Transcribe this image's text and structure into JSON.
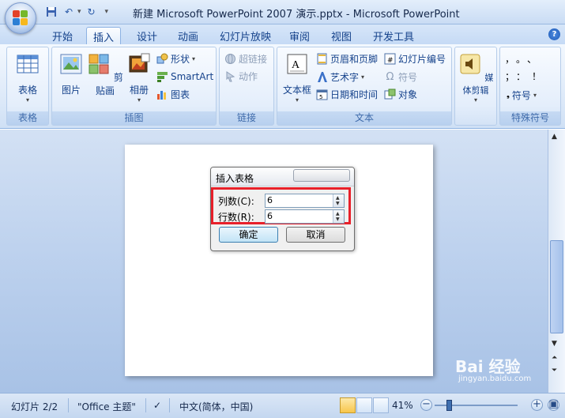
{
  "window": {
    "title": "新建 Microsoft PowerPoint 2007 演示.pptx - Microsoft PowerPoint"
  },
  "quick_access": {
    "save_icon": "save-icon",
    "undo_icon": "undo-icon",
    "redo_icon": "redo-icon"
  },
  "tabs": [
    {
      "label": "开始"
    },
    {
      "label": "插入",
      "active": true
    },
    {
      "label": "设计"
    },
    {
      "label": "动画"
    },
    {
      "label": "幻灯片放映"
    },
    {
      "label": "审阅"
    },
    {
      "label": "视图"
    },
    {
      "label": "开发工具"
    }
  ],
  "ribbon": {
    "groups": {
      "table": {
        "label": "表格",
        "button": "表格"
      },
      "illustrations": {
        "label": "插图",
        "picture": "图片",
        "clipart": "剪贴画",
        "album": "相册",
        "shapes": "形状",
        "smartart": "SmartArt",
        "chart": "图表"
      },
      "links": {
        "label": "链接",
        "hyperlink": "超链接",
        "action": "动作"
      },
      "text": {
        "label": "文本",
        "textbox": "文本框",
        "header_footer": "页眉和页脚",
        "wordart": "艺术字",
        "datetime": "日期和时间",
        "slide_number": "幻灯片编号",
        "symbol": "符号",
        "object": "对象"
      },
      "media": {
        "label": "媒体剪辑"
      },
      "special_symbols": {
        "label": "特殊符号",
        "symbol": "符号",
        "chars": [
          "，",
          "。",
          "、",
          "；",
          "：",
          "！"
        ]
      }
    }
  },
  "dialog": {
    "title": "插入表格",
    "columns_label": "列数(C):",
    "columns_value": "6",
    "rows_label": "行数(R):",
    "rows_value": "6",
    "ok": "确定",
    "cancel": "取消"
  },
  "statusbar": {
    "slide": "幻灯片 2/2",
    "theme": "\"Office 主题\"",
    "language": "中文(简体，中国)",
    "zoom": "41%"
  },
  "watermark": {
    "brand": "Bai 经验",
    "url": "jingyan.baidu.com"
  },
  "colors": {
    "accent": "#15428b",
    "highlight": "#e8202a"
  }
}
